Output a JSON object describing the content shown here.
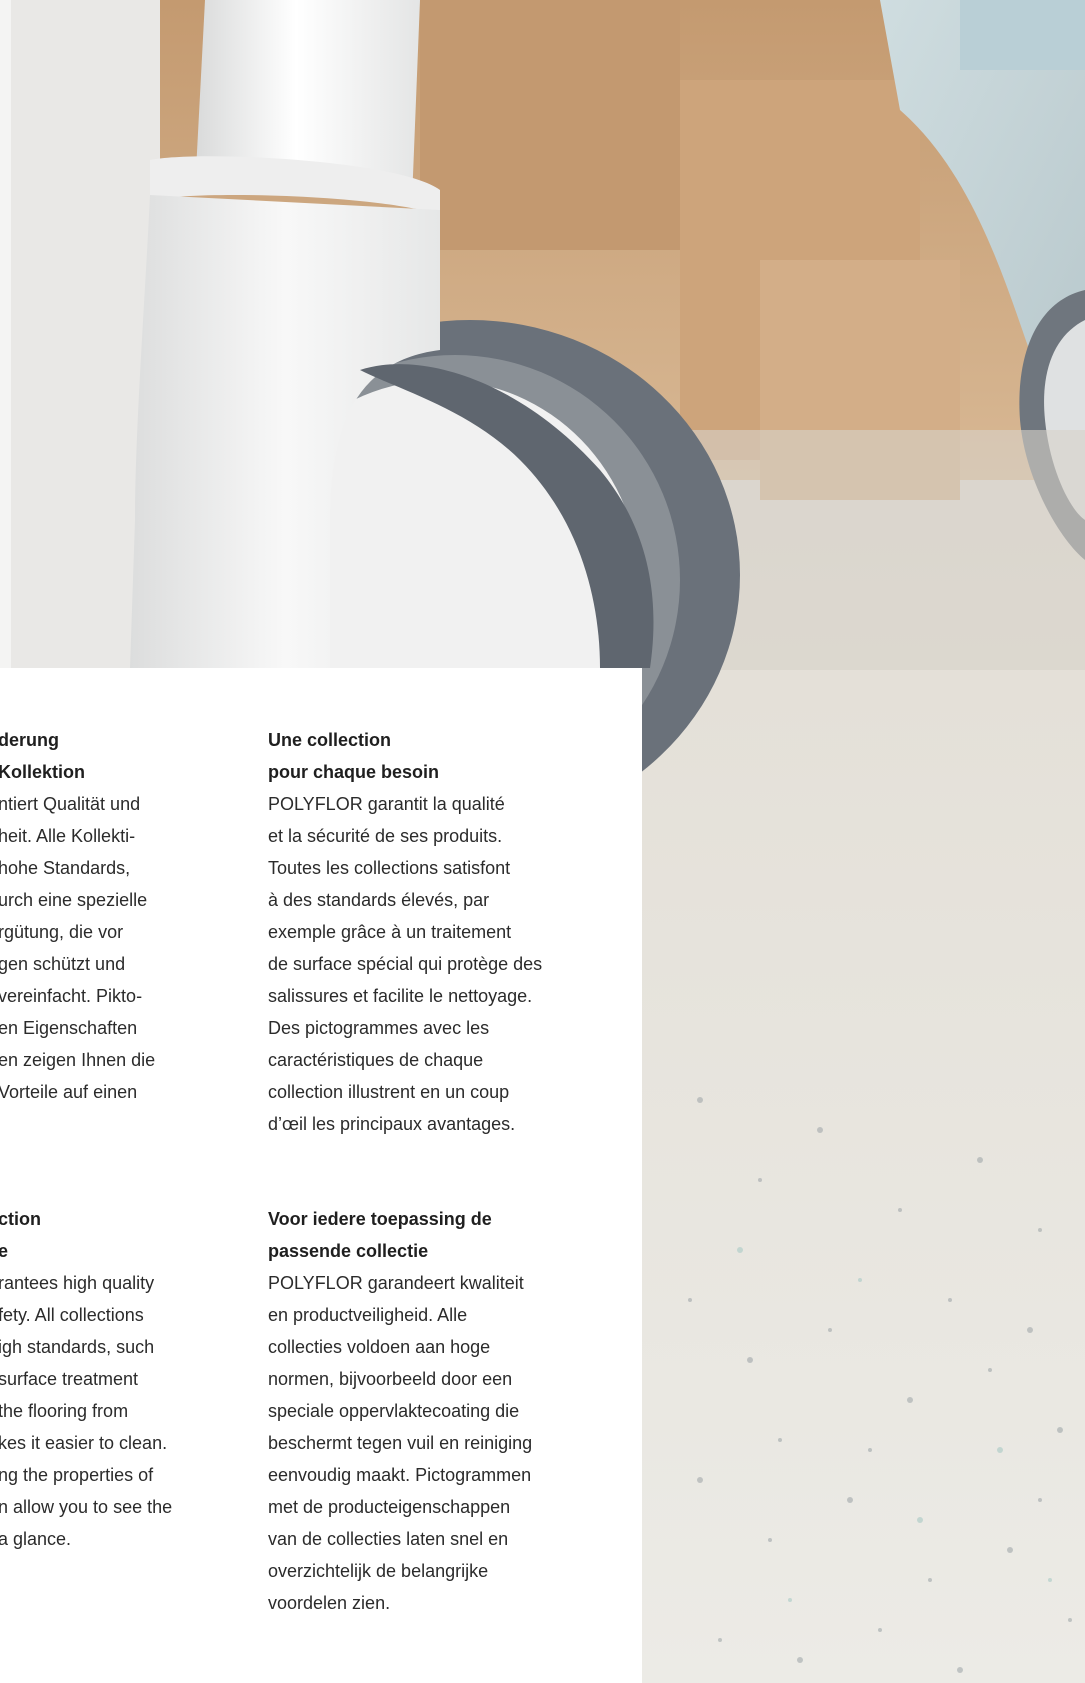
{
  "colors": {
    "panel_bg": "#ffffff",
    "floor": "#e7e4dd",
    "wall": "#c8a27a",
    "wheel": "#6c737c",
    "furniture": "#f2f2f0"
  },
  "sections": {
    "de": {
      "heading": "derung\nKollektion",
      "body": "ntiert Qualität und\nheit. Alle Kollekti-\nhohe Standards,\nurch eine spezielle\nrgütung, die vor\ngen schützt und\nvereinfacht. Pikto-\nen Eigenschaften\nen zeigen Ihnen die\nVorteile auf einen"
    },
    "en": {
      "heading": "ction\ne",
      "body": "rantees high quality\nfety. All collections\nigh standards, such\nsurface treatment\nthe flooring from\nkes it easier to clean.\nng the properties of\nn allow you to see the\n a glance."
    },
    "fr": {
      "heading": "Une collection\npour chaque besoin",
      "body": "POLYFLOR garantit la qualité\net la sécurité de ses produits.\nToutes les collections satisfont\nà des standards élevés, par\nexemple grâce à un traitement\nde surface spécial qui protège des\nsalissures et facilite le nettoyage.\nDes pictogrammes avec les\ncaractéristiques de chaque\ncollection illustrent en un coup\nd’œil les principaux avantages."
    },
    "nl": {
      "heading": "Voor iedere toepassing de\npassende collectie",
      "body": "POLYFLOR garandeert kwaliteit\nen productveiligheid. Alle\ncollecties voldoen aan hoge\nnormen, bijvoorbeeld door een\nspeciale oppervlaktecoating die\nbeschermt tegen vuil en reiniging\neenvoudig maakt. Pictogrammen\nmet de producteigenschappen\nvan de collecties laten snel en\noverzichtelijk de belangrijke\nvoordelen zien."
    }
  }
}
